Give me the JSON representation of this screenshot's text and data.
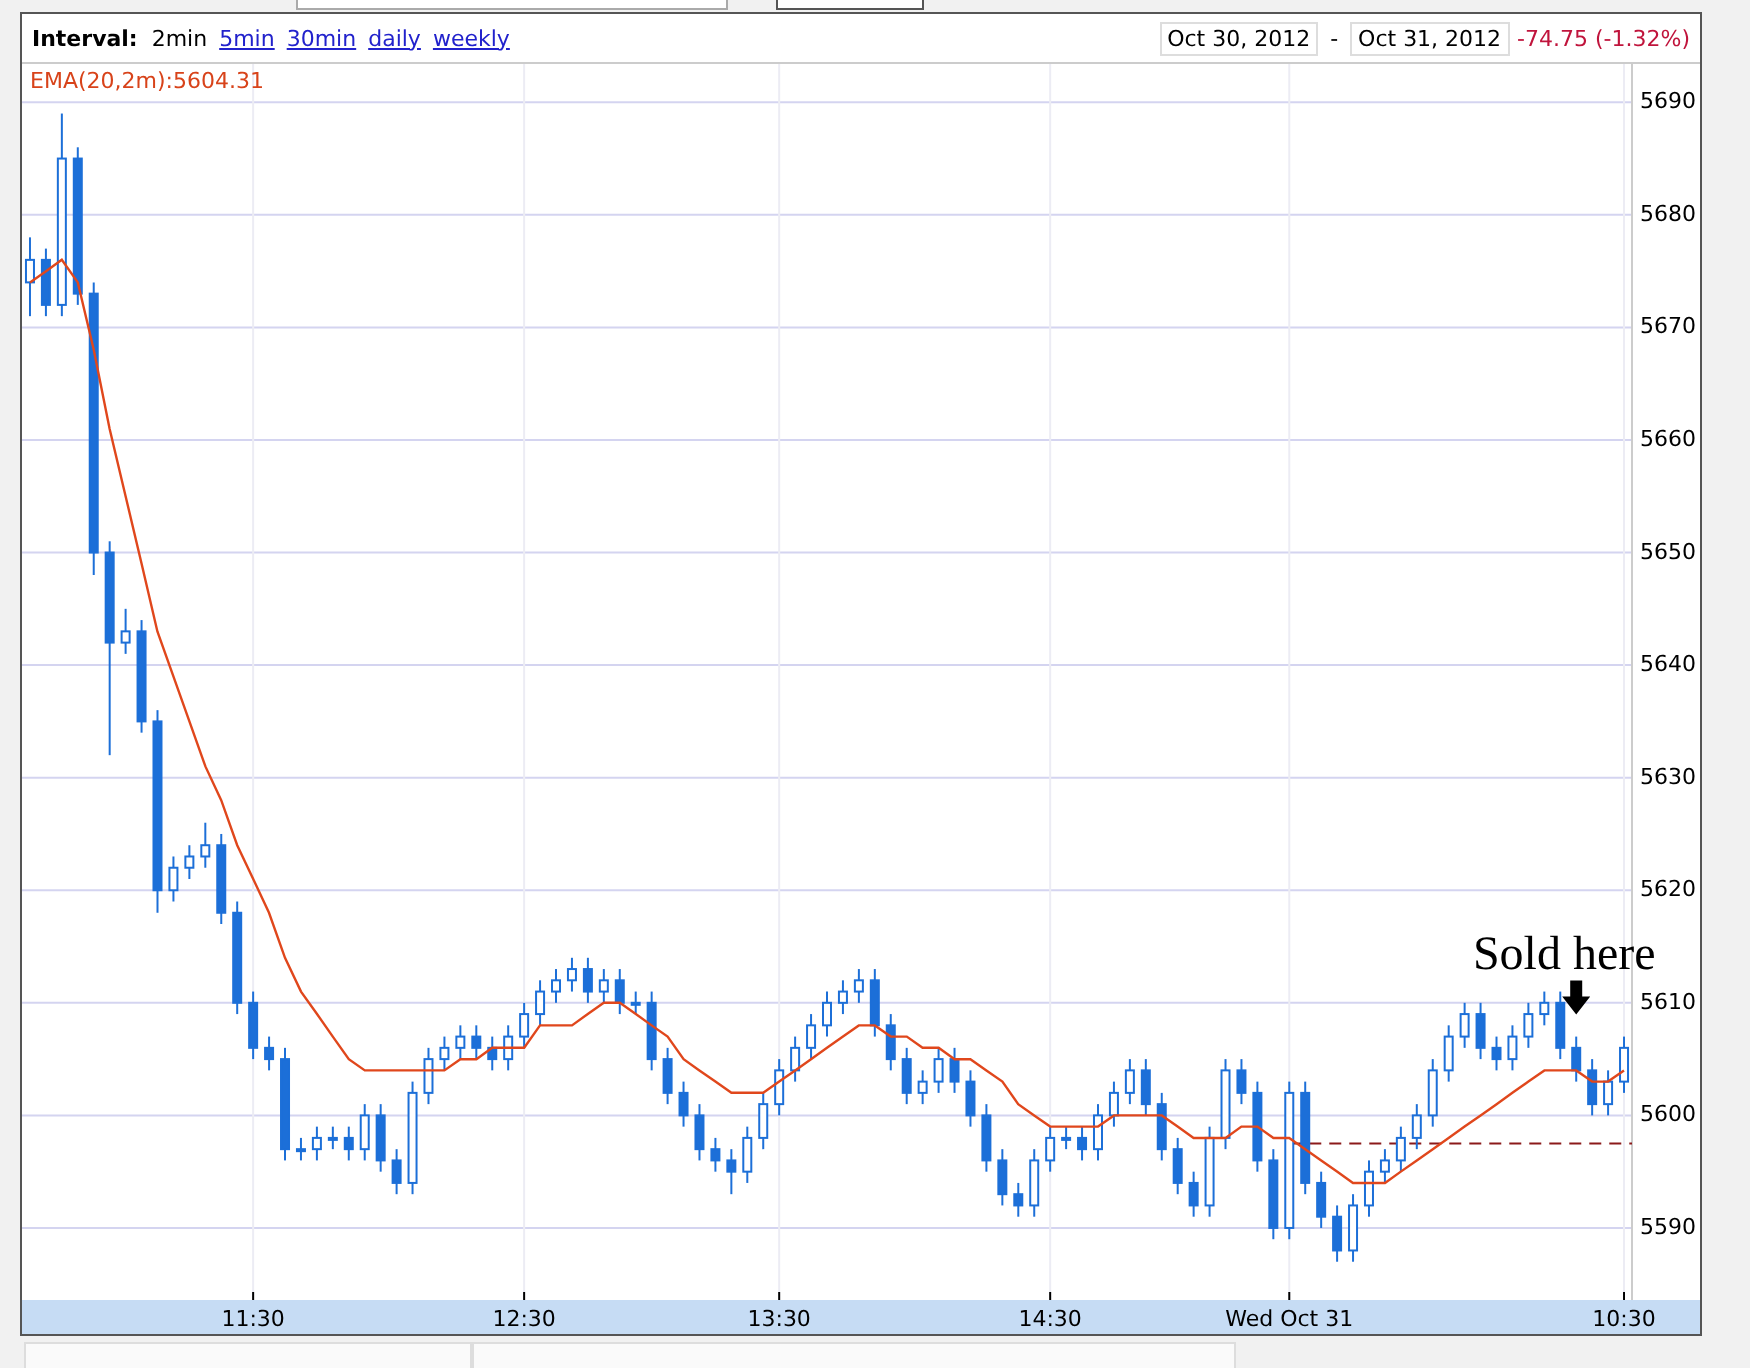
{
  "toolbar": {
    "interval_label": "Interval:",
    "intervals": [
      {
        "label": "2min",
        "selected": true
      },
      {
        "label": "5min",
        "selected": false
      },
      {
        "label": "30min",
        "selected": false
      },
      {
        "label": "daily",
        "selected": false
      },
      {
        "label": "weekly",
        "selected": false
      }
    ],
    "date_from": "Oct 30, 2012",
    "date_separator": "-",
    "date_to": "Oct 31, 2012",
    "change": "-74.75 (-1.32%)"
  },
  "indicator_reading": ":5604.31",
  "chart_data": {
    "type": "candlestick",
    "grid": true,
    "ylim": [
      5583.6,
      5693.4
    ],
    "categories": [
      null,
      null,
      null,
      null,
      null,
      null,
      null,
      null,
      null,
      null,
      null,
      null,
      null,
      null,
      "11:30",
      null,
      null,
      null,
      null,
      null,
      null,
      null,
      null,
      null,
      null,
      null,
      null,
      null,
      null,
      null,
      null,
      "12:30",
      null,
      null,
      null,
      null,
      null,
      null,
      null,
      null,
      null,
      null,
      null,
      null,
      null,
      null,
      null,
      "13:30",
      null,
      null,
      null,
      null,
      null,
      null,
      null,
      null,
      null,
      null,
      null,
      null,
      null,
      null,
      null,
      null,
      "14:30",
      null,
      null,
      null,
      null,
      null,
      null,
      null,
      null,
      null,
      null,
      null,
      null,
      null,
      null,
      "Wed Oct 31",
      null,
      null,
      null,
      null,
      null,
      null,
      null,
      null,
      null,
      null,
      null,
      null,
      null,
      null,
      null,
      null,
      null,
      null,
      null,
      null,
      "10:30"
    ],
    "yticks": [
      5590,
      5600,
      5610,
      5620,
      5630,
      5640,
      5650,
      5660,
      5670,
      5680,
      5690
    ],
    "ohlc": [
      [
        5674,
        5678,
        5671,
        5676
      ],
      [
        5676,
        5677,
        5671,
        5672
      ],
      [
        5672,
        5689,
        5671,
        5685
      ],
      [
        5685,
        5686,
        5672,
        5673
      ],
      [
        5673,
        5674,
        5648,
        5650
      ],
      [
        5650,
        5651,
        5632,
        5642
      ],
      [
        5642,
        5645,
        5641,
        5643
      ],
      [
        5643,
        5644,
        5634,
        5635
      ],
      [
        5635,
        5636,
        5618,
        5620
      ],
      [
        5620,
        5623,
        5619,
        5622
      ],
      [
        5622,
        5624,
        5621,
        5623
      ],
      [
        5623,
        5626,
        5622,
        5624
      ],
      [
        5624,
        5625,
        5617,
        5618
      ],
      [
        5618,
        5619,
        5609,
        5610
      ],
      [
        5610,
        5611,
        5605,
        5606
      ],
      [
        5606,
        5607,
        5604,
        5605
      ],
      [
        5605,
        5606,
        5596,
        5597
      ],
      [
        5597,
        5598,
        5596,
        5597
      ],
      [
        5597,
        5599,
        5596,
        5598
      ],
      [
        5598,
        5599,
        5597,
        5598
      ],
      [
        5598,
        5599,
        5596,
        5597
      ],
      [
        5597,
        5601,
        5596,
        5600
      ],
      [
        5600,
        5601,
        5595,
        5596
      ],
      [
        5596,
        5597,
        5593,
        5594
      ],
      [
        5594,
        5603,
        5593,
        5602
      ],
      [
        5602,
        5606,
        5601,
        5605
      ],
      [
        5605,
        5607,
        5604,
        5606
      ],
      [
        5606,
        5608,
        5605,
        5607
      ],
      [
        5607,
        5608,
        5605,
        5606
      ],
      [
        5606,
        5607,
        5604,
        5605
      ],
      [
        5605,
        5608,
        5604,
        5607
      ],
      [
        5607,
        5610,
        5606,
        5609
      ],
      [
        5609,
        5612,
        5608,
        5611
      ],
      [
        5611,
        5613,
        5610,
        5612
      ],
      [
        5612,
        5614,
        5611,
        5613
      ],
      [
        5613,
        5614,
        5610,
        5611
      ],
      [
        5611,
        5613,
        5610,
        5612
      ],
      [
        5612,
        5613,
        5609,
        5610
      ],
      [
        5610,
        5611,
        5609,
        5610
      ],
      [
        5610,
        5611,
        5604,
        5605
      ],
      [
        5605,
        5606,
        5601,
        5602
      ],
      [
        5602,
        5603,
        5599,
        5600
      ],
      [
        5600,
        5601,
        5596,
        5597
      ],
      [
        5597,
        5598,
        5595,
        5596
      ],
      [
        5596,
        5597,
        5593,
        5595
      ],
      [
        5595,
        5599,
        5594,
        5598
      ],
      [
        5598,
        5602,
        5597,
        5601
      ],
      [
        5601,
        5605,
        5600,
        5604
      ],
      [
        5604,
        5607,
        5603,
        5606
      ],
      [
        5606,
        5609,
        5605,
        5608
      ],
      [
        5608,
        5611,
        5607,
        5610
      ],
      [
        5610,
        5612,
        5609,
        5611
      ],
      [
        5611,
        5613,
        5610,
        5612
      ],
      [
        5612,
        5613,
        5607,
        5608
      ],
      [
        5608,
        5609,
        5604,
        5605
      ],
      [
        5605,
        5606,
        5601,
        5602
      ],
      [
        5602,
        5604,
        5601,
        5603
      ],
      [
        5603,
        5606,
        5602,
        5605
      ],
      [
        5605,
        5606,
        5602,
        5603
      ],
      [
        5603,
        5604,
        5599,
        5600
      ],
      [
        5600,
        5601,
        5595,
        5596
      ],
      [
        5596,
        5597,
        5592,
        5593
      ],
      [
        5593,
        5594,
        5591,
        5592
      ],
      [
        5592,
        5597,
        5591,
        5596
      ],
      [
        5596,
        5599,
        5595,
        5598
      ],
      [
        5598,
        5599,
        5597,
        5598
      ],
      [
        5598,
        5599,
        5596,
        5597
      ],
      [
        5597,
        5601,
        5596,
        5600
      ],
      [
        5600,
        5603,
        5599,
        5602
      ],
      [
        5602,
        5605,
        5601,
        5604
      ],
      [
        5604,
        5605,
        5600,
        5601
      ],
      [
        5601,
        5602,
        5596,
        5597
      ],
      [
        5597,
        5598,
        5593,
        5594
      ],
      [
        5594,
        5595,
        5591,
        5592
      ],
      [
        5592,
        5599,
        5591,
        5598
      ],
      [
        5598,
        5605,
        5597,
        5604
      ],
      [
        5604,
        5605,
        5601,
        5602
      ],
      [
        5602,
        5603,
        5595,
        5596
      ],
      [
        5596,
        5597,
        5589,
        5590
      ],
      [
        5590,
        5603,
        5589,
        5602
      ],
      [
        5602,
        5603,
        5593,
        5594
      ],
      [
        5594,
        5595,
        5590,
        5591
      ],
      [
        5591,
        5592,
        5587,
        5588
      ],
      [
        5588,
        5593,
        5587,
        5592
      ],
      [
        5592,
        5596,
        5591,
        5595
      ],
      [
        5595,
        5597,
        5594,
        5596
      ],
      [
        5596,
        5599,
        5595,
        5598
      ],
      [
        5598,
        5601,
        5597,
        5600
      ],
      [
        5600,
        5605,
        5599,
        5604
      ],
      [
        5604,
        5608,
        5603,
        5607
      ],
      [
        5607,
        5610,
        5606,
        5609
      ],
      [
        5609,
        5610,
        5605,
        5606
      ],
      [
        5606,
        5607,
        5604,
        5605
      ],
      [
        5605,
        5608,
        5604,
        5607
      ],
      [
        5607,
        5610,
        5606,
        5609
      ],
      [
        5609,
        5611,
        5608,
        5610
      ],
      [
        5610,
        5611,
        5605,
        5606
      ],
      [
        5606,
        5607,
        5603,
        5604
      ],
      [
        5604,
        5605,
        5600,
        5601
      ],
      [
        5601,
        5604,
        5600,
        5603
      ],
      [
        5603,
        5607,
        5602,
        5606
      ]
    ],
    "series": [
      {
        "name": "EMA(20,2m)",
        "type": "line",
        "color": "#e0471c",
        "values": [
          5674,
          5675,
          5676,
          5674,
          5668,
          5661,
          5655,
          5649,
          5643,
          5639,
          5635,
          5631,
          5628,
          5624,
          5621,
          5618,
          5614,
          5611,
          5609,
          5607,
          5605,
          5604,
          5604,
          5604,
          5604,
          5604,
          5604,
          5605,
          5605,
          5606,
          5606,
          5606,
          5608,
          5608,
          5608,
          5609,
          5610,
          5610,
          5609,
          5608,
          5607,
          5605,
          5604,
          5603,
          5602,
          5602,
          5602,
          5603,
          5604,
          5605,
          5606,
          5607,
          5608,
          5608,
          5607,
          5607,
          5606,
          5606,
          5605,
          5605,
          5604,
          5603,
          5601,
          5600,
          5599,
          5599,
          5599,
          5599,
          5600,
          5600,
          5600,
          5600,
          5599,
          5598,
          5598,
          5598,
          5599,
          5599,
          5598,
          5598,
          5597,
          5596,
          5595,
          5594,
          5594,
          5594,
          5595,
          5596,
          5597,
          5598,
          5599,
          5600,
          5601,
          5602,
          5603,
          5604,
          5604,
          5604,
          5603,
          5603,
          5604
        ]
      }
    ],
    "ref_lines": [
      {
        "axis": "y",
        "value": 5597.5,
        "color": "#8b1a1a"
      }
    ],
    "annotations": [
      "Sold here"
    ]
  }
}
